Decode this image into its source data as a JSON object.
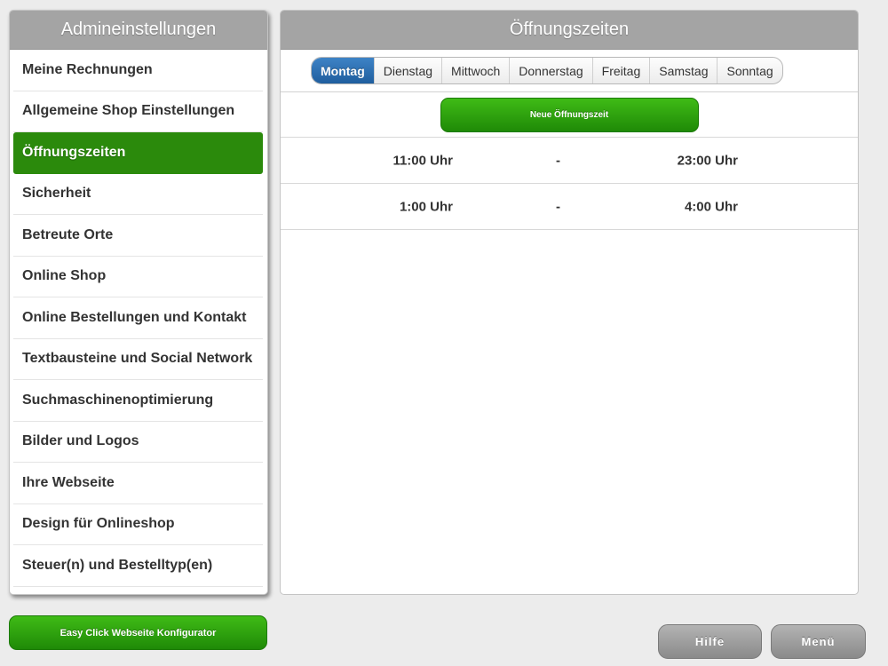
{
  "sidebar": {
    "title": "Admineinstellungen",
    "items": [
      {
        "label": "Meine Rechnungen"
      },
      {
        "label": "Allgemeine Shop Einstellungen"
      },
      {
        "label": "Öffnungszeiten"
      },
      {
        "label": "Sicherheit"
      },
      {
        "label": "Betreute Orte"
      },
      {
        "label": "Online Shop"
      },
      {
        "label": "Online Bestellungen und Kontakt"
      },
      {
        "label": "Textbausteine und Social Network"
      },
      {
        "label": "Suchmaschinenoptimierung"
      },
      {
        "label": "Bilder und Logos"
      },
      {
        "label": "Ihre Webseite"
      },
      {
        "label": "Design für Onlineshop"
      },
      {
        "label": "Steuer(n) und Bestelltyp(en)"
      }
    ],
    "active_item": "Öffnungszeiten"
  },
  "main": {
    "title": "Öffnungszeiten",
    "tabs": [
      {
        "label": "Montag"
      },
      {
        "label": "Dienstag"
      },
      {
        "label": "Mittwoch"
      },
      {
        "label": "Donnerstag"
      },
      {
        "label": "Freitag"
      },
      {
        "label": "Samstag"
      },
      {
        "label": "Sonntag"
      }
    ],
    "active_tab": "Montag",
    "new_button_label": "Neue Öffnungszeit",
    "times": [
      {
        "from": "11:00 Uhr",
        "separator": "-",
        "to": "23:00 Uhr"
      },
      {
        "from": "1:00 Uhr",
        "separator": "-",
        "to": "4:00 Uhr"
      }
    ]
  },
  "footer": {
    "config_button_label": "Easy Click Webseite Konfigurator",
    "help_button_label": "Hilfe",
    "menu_button_label": "Menü"
  },
  "colors": {
    "active_green": "#2b8a0c",
    "active_tab_blue": "#2c6fb0",
    "header_gray": "#a4a4a4"
  }
}
